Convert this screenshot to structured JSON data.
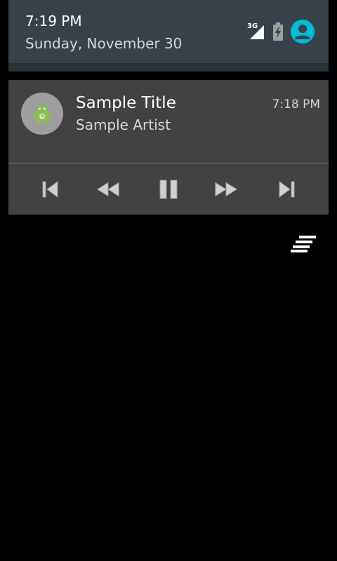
{
  "header": {
    "time": "7:19 PM",
    "date": "Sunday, November 30",
    "network_type": "3G",
    "icons": [
      "signal-3g-icon",
      "battery-charging-icon",
      "user-account-icon"
    ],
    "accent_color": "#00bcd4"
  },
  "notification": {
    "app_icon": "android-robot-icon",
    "title": "Sample Title",
    "artist": "Sample Artist",
    "time": "7:18 PM",
    "controls": [
      {
        "name": "previous",
        "icon": "skip-previous-icon"
      },
      {
        "name": "rewind",
        "icon": "rewind-icon"
      },
      {
        "name": "pause",
        "icon": "pause-icon"
      },
      {
        "name": "fast-forward",
        "icon": "fast-forward-icon"
      },
      {
        "name": "next",
        "icon": "skip-next-icon"
      }
    ]
  },
  "background_icon": "notification-menu-icon"
}
